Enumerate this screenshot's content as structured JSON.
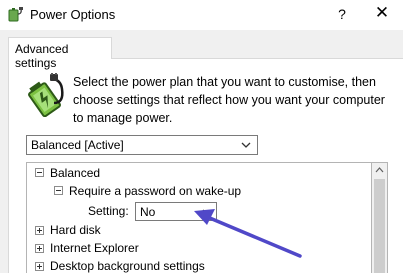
{
  "window": {
    "title": "Power Options",
    "help_label": "?",
    "close_label": "✕"
  },
  "tabs": [
    {
      "label": "Advanced settings",
      "active": true
    }
  ],
  "description": "Select the power plan that you want to customise, then choose settings that reflect how you want your computer to manage power.",
  "plan_select": {
    "value": "Balanced [Active]"
  },
  "tree": {
    "root": {
      "label": "Balanced",
      "expanded": true
    },
    "password_node": {
      "label": "Require a password on wake-up",
      "expanded": true
    },
    "setting": {
      "label": "Setting:",
      "value": "No"
    },
    "items": [
      {
        "label": "Hard disk",
        "expanded": false
      },
      {
        "label": "Internet Explorer",
        "expanded": false
      },
      {
        "label": "Desktop background settings",
        "expanded": false
      }
    ]
  },
  "colors": {
    "annotation_arrow": "#5048c8",
    "window_bg": "#f0f0f0",
    "panel_bg": "#ffffff"
  },
  "icons": [
    "power-options-icon",
    "battery-plug-icon",
    "help-icon",
    "close-icon",
    "chevron-down-icon",
    "expand-icon",
    "collapse-icon",
    "annotation-arrow"
  ]
}
